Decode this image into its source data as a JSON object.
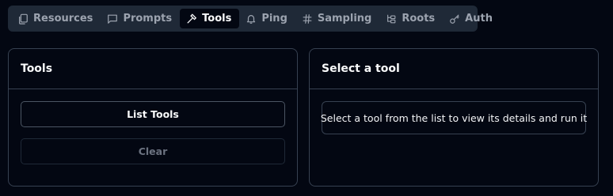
{
  "tabs": [
    {
      "label": "Resources",
      "icon": "files-icon",
      "active": false
    },
    {
      "label": "Prompts",
      "icon": "message-square-icon",
      "active": false
    },
    {
      "label": "Tools",
      "icon": "hammer-icon",
      "active": true
    },
    {
      "label": "Ping",
      "icon": "bell-icon",
      "active": false
    },
    {
      "label": "Sampling",
      "icon": "hash-icon",
      "active": false
    },
    {
      "label": "Roots",
      "icon": "folder-tree-icon",
      "active": false
    },
    {
      "label": "Auth",
      "icon": "key-icon",
      "active": false
    }
  ],
  "tools_panel": {
    "title": "Tools",
    "list_button": "List Tools",
    "clear_button": "Clear"
  },
  "detail_panel": {
    "title": "Select a tool",
    "message": "Select a tool from the list to view its details and run it"
  },
  "colors": {
    "background": "#030712",
    "tabbar": "#1f2937",
    "border": "#374151",
    "text": "#f9fafb",
    "muted": "#9ca3af"
  }
}
